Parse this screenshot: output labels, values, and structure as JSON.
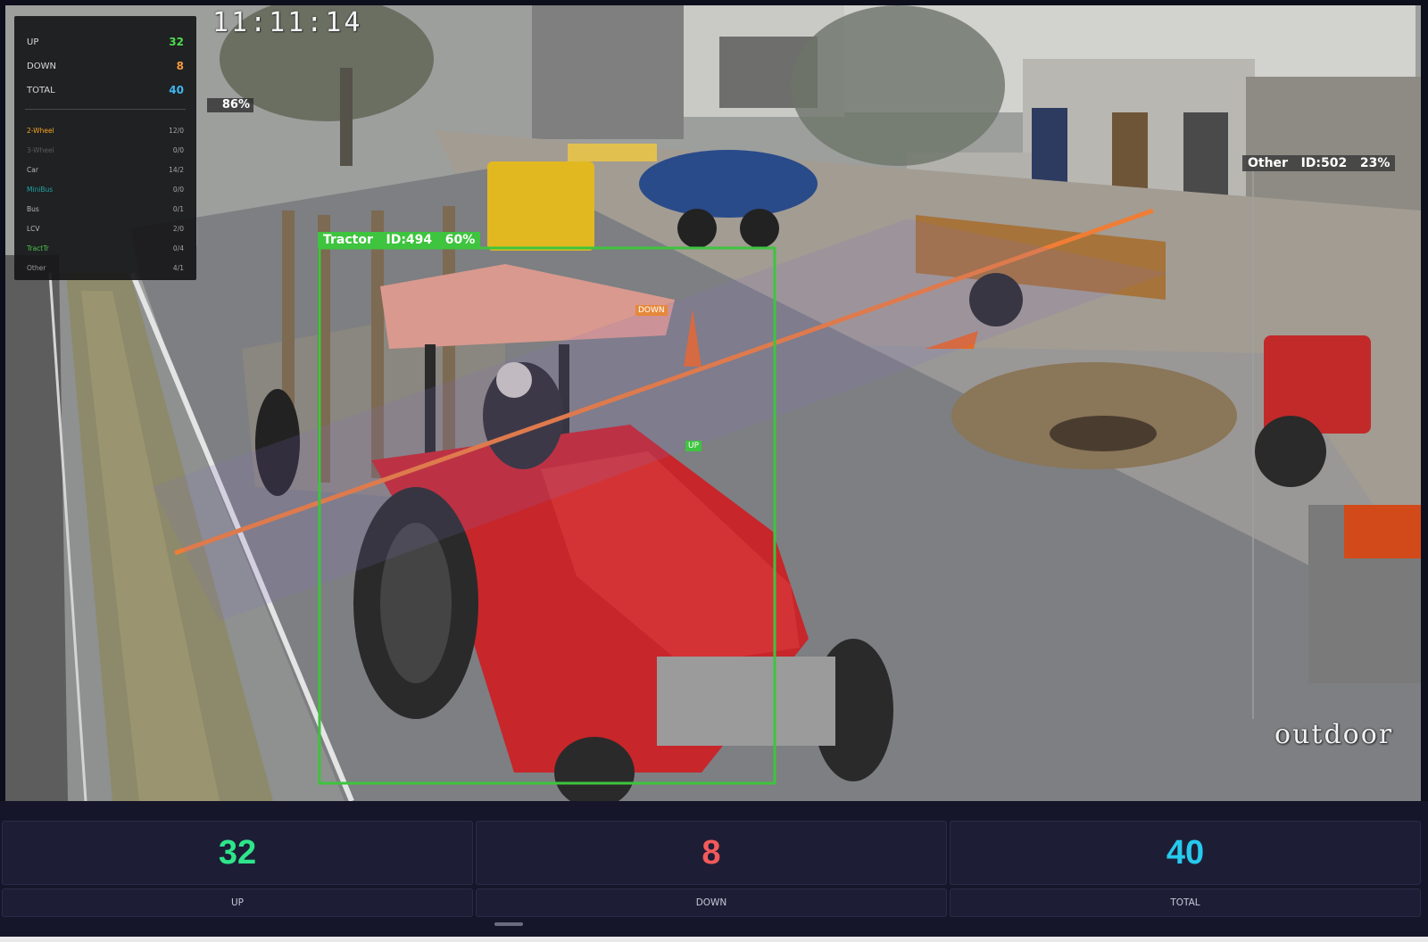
{
  "video": {
    "timestamp": "11:11:14",
    "watermark": "outdoor",
    "corner_confidence": "86%",
    "overlay": {
      "up_label": "UP",
      "up_value": "32",
      "down_label": "DOWN",
      "down_value": "8",
      "total_label": "TOTAL",
      "total_value": "40",
      "classes": [
        {
          "name": "2-Wheel",
          "count": "12/0",
          "color": "#f5a623"
        },
        {
          "name": "3-Wheel",
          "count": "0/0",
          "color": "#5a5a5a"
        },
        {
          "name": "Car",
          "count": "14/2",
          "color": "#b8b8b8"
        },
        {
          "name": "MiniBus",
          "count": "0/0",
          "color": "#1fa3a3"
        },
        {
          "name": "Bus",
          "count": "0/1",
          "color": "#b8b8b8"
        },
        {
          "name": "LCV",
          "count": "2/0",
          "color": "#b8b8b8"
        },
        {
          "name": "TractTr",
          "count": "0/4",
          "color": "#4cc24c"
        },
        {
          "name": "Other",
          "count": "4/1",
          "color": "#9a9a9a"
        }
      ],
      "colors": {
        "up": "#4ddc4d",
        "down": "#f59a3c",
        "total": "#3fb6f0"
      }
    },
    "detections": [
      {
        "label": "Tractor   ID:494   60%",
        "color": "#3ec43e"
      },
      {
        "label": "Other   ID:502   23%",
        "color": "#333333"
      }
    ],
    "line_tags": {
      "down": "DOWN",
      "up": "UP"
    }
  },
  "stats_bar": {
    "up": {
      "value": "32",
      "label": "UP",
      "color": "#2ee58a"
    },
    "down": {
      "value": "8",
      "label": "DOWN",
      "color": "#f25a5a"
    },
    "total": {
      "value": "40",
      "label": "TOTAL",
      "color": "#27c9ee"
    }
  }
}
